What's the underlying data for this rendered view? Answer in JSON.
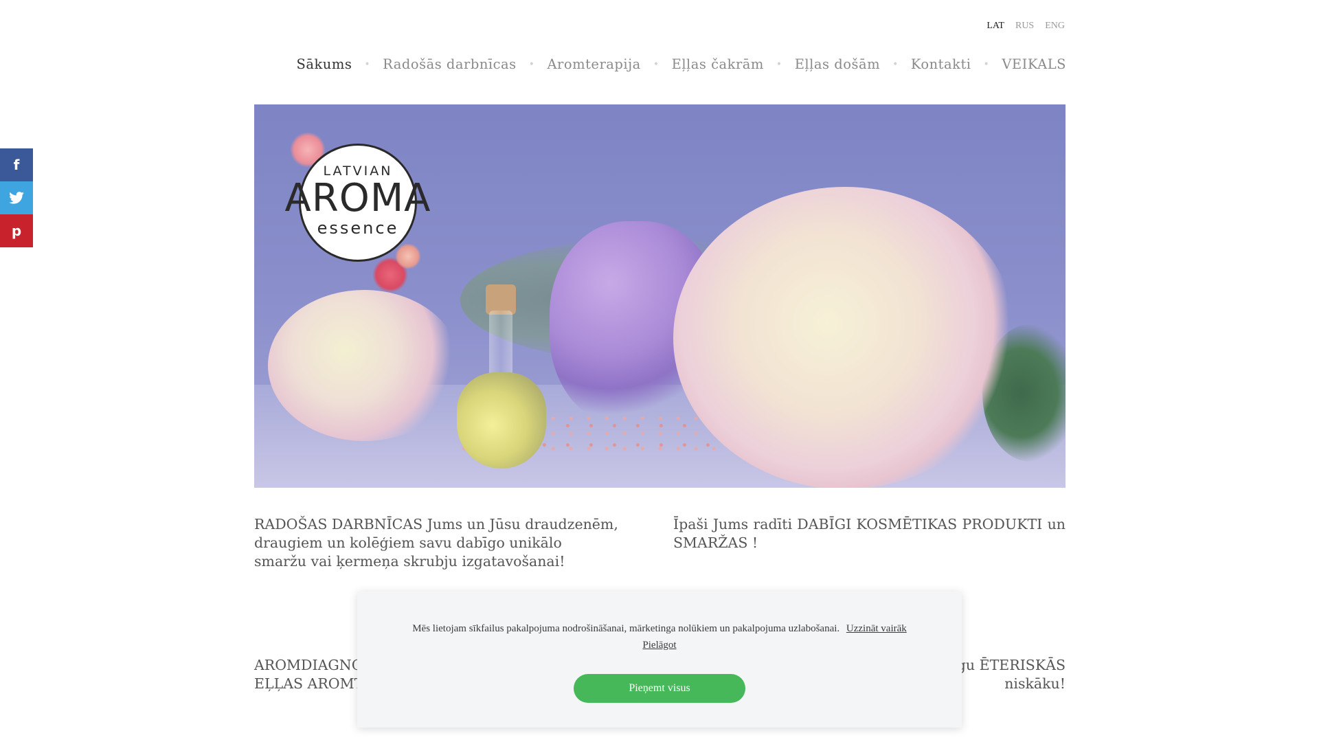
{
  "language_switcher": {
    "items": [
      "LAT",
      "RUS",
      "ENG"
    ],
    "active": "LAT"
  },
  "nav": {
    "items": [
      "Sākums",
      "Radošās darbnīcas",
      "Aromterapija",
      "Eļļas čakrām",
      "Eļļas došām",
      "Kontakti",
      "VEIKALS"
    ],
    "active": "Sākums"
  },
  "hero": {
    "logo_line1": "LATVIAN",
    "logo_line2": "AROMA",
    "logo_line3": "essence"
  },
  "social": {
    "facebook": "f",
    "twitter": "t",
    "pinterest": "p"
  },
  "content": {
    "col1": "RADOŠAS DARBNĪCAS Jums un Jūsu draudzenēm, draugiem un kolēģiem savu dabīgo unikālo smaržu vai ķermeņa skrubju izgatavošanai!",
    "col2": "Īpaši Jums radīti DABĪGI KOSMĒTIKAS PRODUKTI un SMARŽAS !",
    "col3": "AROMDIAGNOS\nEĻĻAS AROMTE",
    "col4": "ugu ĒTERISKĀS\nniskāku!"
  },
  "cookie": {
    "message": "Mēs lietojam sīkfailus pakalpojuma nodrošināšanai, mārketinga nolūkiem un pakalpojuma uzlabošanai.",
    "learn_more": "Uzzināt vairāk",
    "customize": "Pielāgot",
    "accept": "Pieņemt visus"
  },
  "colors": {
    "accept_green": "#46b85a",
    "facebook": "#3b5998",
    "twitter": "#3fa5e0",
    "pinterest": "#c8232c"
  },
  "icons": [
    "facebook-icon",
    "twitter-icon",
    "pinterest-icon"
  ]
}
